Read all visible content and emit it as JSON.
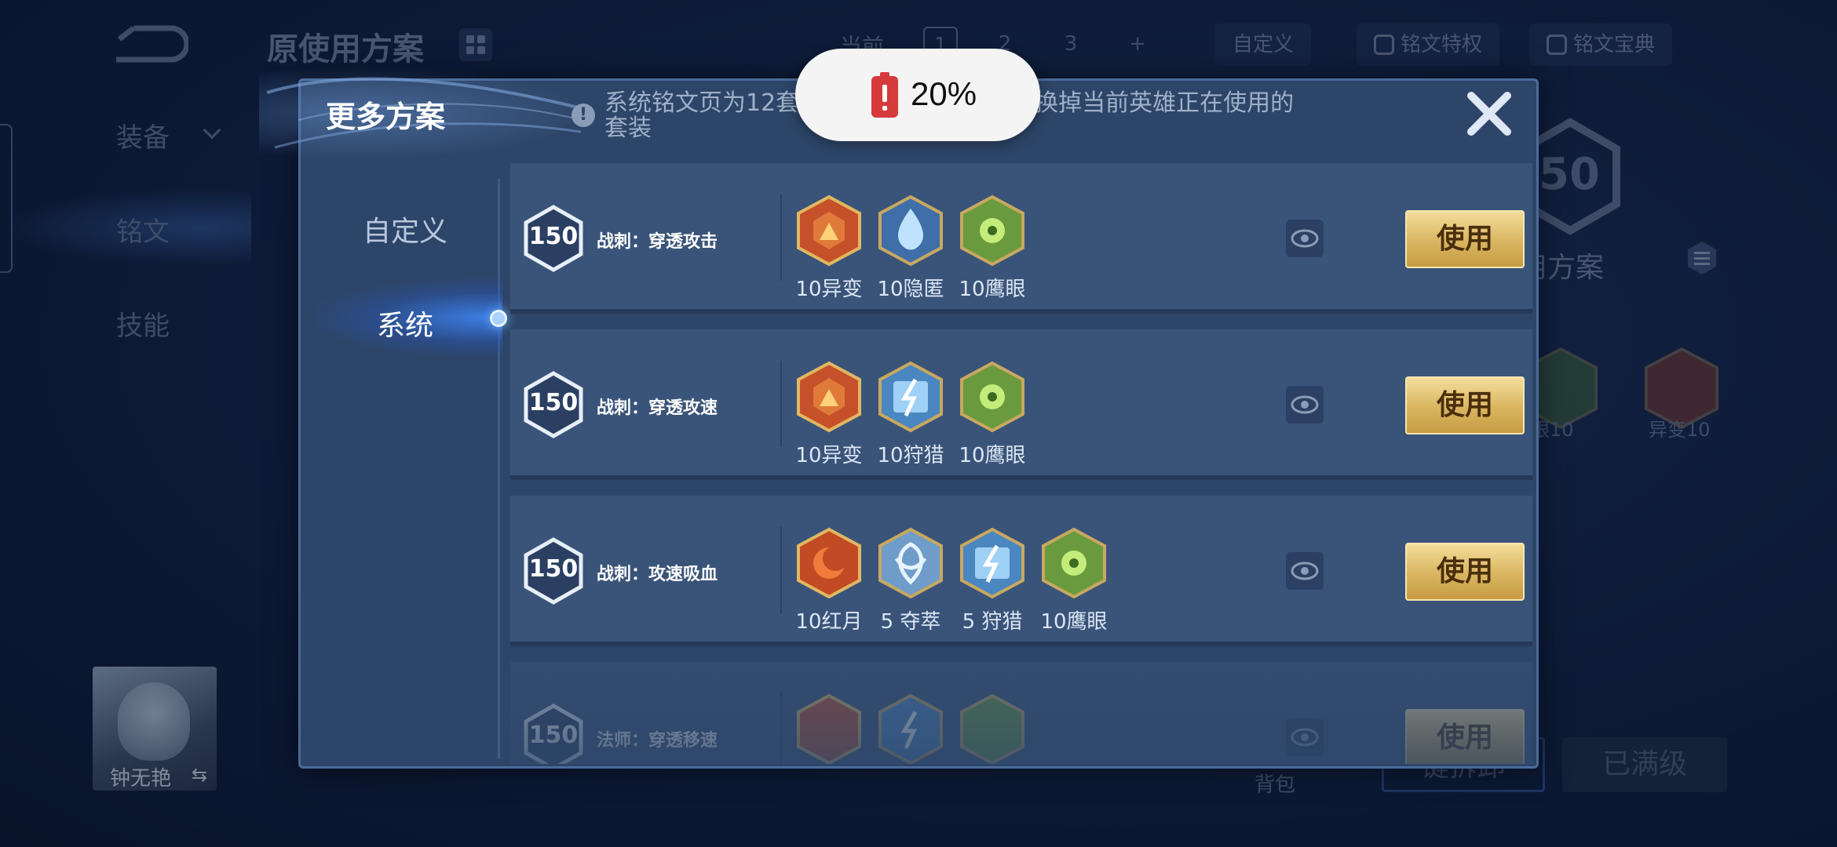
{
  "background": {
    "title": "原使用方案",
    "current_label": "当前",
    "page_tabs": [
      "1",
      "2",
      "3",
      "+"
    ],
    "custom_btn": "自定义",
    "privilege_btn": "铭文特权",
    "guide_btn": "铭文宝典",
    "side_items": [
      "装备",
      "铭文",
      "技能"
    ],
    "hero_name": "钟无艳",
    "hero_swap": "⇆",
    "level": "50",
    "scheme_label": "用方案",
    "rune_labels": [
      "眼10",
      "异变10"
    ],
    "bag_label": "背包",
    "bottom_buttons": [
      "键拆卸",
      "已满级"
    ]
  },
  "modal": {
    "title": "更多方案",
    "notice": "系统铭文页为12套固定方案，使用后会替换掉当前英雄正在使用的套装",
    "tabs": {
      "custom": "自定义",
      "system": "系统"
    },
    "rows": [
      {
        "level": "150",
        "name": "战刺：穿透攻击",
        "runes": [
          {
            "icon": "rune-red-mutation",
            "label": "10异变"
          },
          {
            "icon": "rune-blue-stealth",
            "label": "10隐匿"
          },
          {
            "icon": "rune-green-hawkeye",
            "label": "10鹰眼"
          }
        ],
        "use_label": "使用"
      },
      {
        "level": "150",
        "name": "战刺：穿透攻速",
        "runes": [
          {
            "icon": "rune-red-mutation",
            "label": "10异变"
          },
          {
            "icon": "rune-blue-hunter",
            "label": "10狩猎"
          },
          {
            "icon": "rune-green-hawkeye",
            "label": "10鹰眼"
          }
        ],
        "use_label": "使用"
      },
      {
        "level": "150",
        "name": "战刺：攻速吸血",
        "runes": [
          {
            "icon": "rune-red-moon",
            "label": "10红月"
          },
          {
            "icon": "rune-blue-seize",
            "label": "5 夺萃"
          },
          {
            "icon": "rune-blue-hunter",
            "label": "5 狩猎"
          },
          {
            "icon": "rune-green-hawkeye",
            "label": "10鹰眼"
          }
        ],
        "use_label": "使用"
      },
      {
        "level": "150",
        "name": "法师：穿透移速",
        "runes": [
          {
            "icon": "rune-red",
            "label": ""
          },
          {
            "icon": "rune-blue-hunter",
            "label": ""
          },
          {
            "icon": "rune-green",
            "label": ""
          }
        ],
        "use_label": "使用"
      }
    ]
  },
  "toast": {
    "battery": "20%"
  },
  "colors": {
    "accent_gold": "#d9b561",
    "modal_bg": "#2d4568",
    "row_bg": "#3a5479",
    "battery_red": "#d63a3a"
  }
}
